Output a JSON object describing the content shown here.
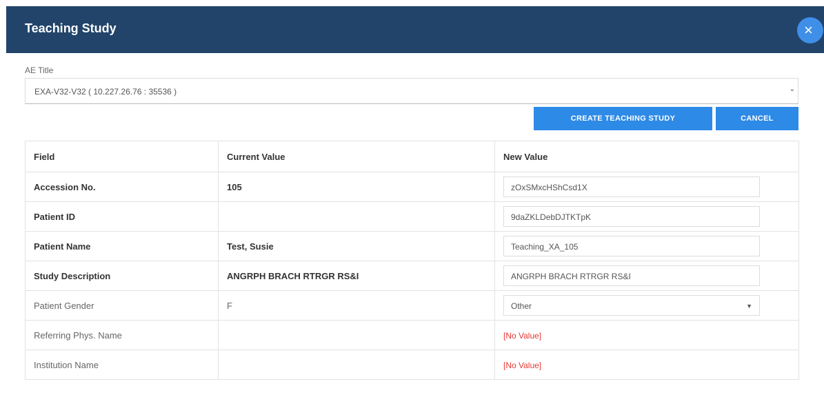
{
  "dialog": {
    "title": "Teaching Study",
    "close_icon": "close-icon",
    "close_glyph": "×"
  },
  "ae_title": {
    "label": "AE Title",
    "value": "EXA-V32-V32 ( 10.227.26.76 : 35536 )",
    "chevron": "⌄"
  },
  "actions": {
    "create_label": "CREATE TEACHING STUDY",
    "cancel_label": "CANCEL"
  },
  "table": {
    "headers": {
      "field": "Field",
      "current": "Current Value",
      "new": "New Value"
    },
    "rows": [
      {
        "field": "Accession No.",
        "current": "105",
        "new": "zOxSMxcHShCsd1X"
      },
      {
        "field": "Patient ID",
        "current": "",
        "new": "9daZKLDebDJTKTpK"
      },
      {
        "field": "Patient Name",
        "current": "Test, Susie",
        "new": "Teaching_XA_105"
      },
      {
        "field": "Study Description",
        "current": "ANGRPH BRACH RTRGR RS&I",
        "new": "ANGRPH BRACH RTRGR RS&I"
      },
      {
        "field": "Patient Gender",
        "current": "F",
        "new": "Other"
      },
      {
        "field": "Referring Phys. Name",
        "current": "",
        "new": "[No Value]"
      },
      {
        "field": "Institution Name",
        "current": "",
        "new": "[No Value]"
      }
    ]
  },
  "colors": {
    "header_bg": "#22446b",
    "button_bg": "#2d8ae6",
    "close_bg": "#3f8fe8",
    "no_value": "#e53935"
  }
}
